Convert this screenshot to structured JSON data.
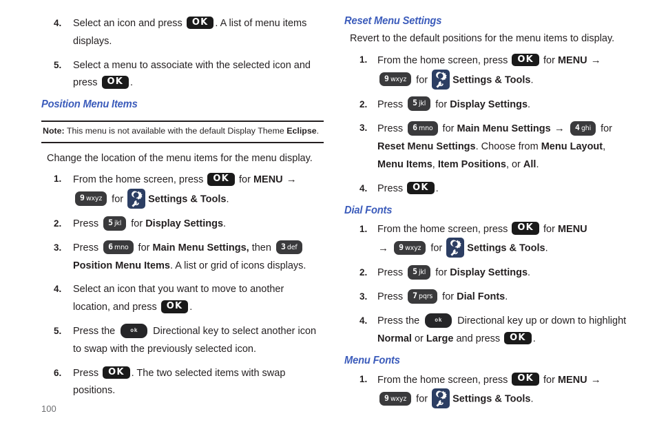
{
  "page": {
    "number": "100",
    "icons": {
      "settings_tools": "settings-tools-icon",
      "ok_key": "ok-key-icon",
      "directional_key": "directional-key-icon"
    },
    "colors": {
      "heading_blue": "#3c5cbb",
      "key_black": "#1a1a1a",
      "key_grey": "#3a3a3c",
      "icon_navy": "#2c3e63",
      "page_number_grey": "#6d6e71",
      "text_black": "#231f20"
    }
  },
  "keys": {
    "ok": "OK",
    "dir": "ok",
    "k9": {
      "digit": "9",
      "letters": "wxyz"
    },
    "k5": {
      "digit": "5",
      "letters": "jkl"
    },
    "k6": {
      "digit": "6",
      "letters": "mno"
    },
    "k3": {
      "digit": "3",
      "letters": "def"
    },
    "k4": {
      "digit": "4",
      "letters": "ghi"
    },
    "k7": {
      "digit": "7",
      "letters": "pqrs"
    }
  },
  "left_column": {
    "continued_steps": [
      {
        "num": "4.",
        "parts": [
          {
            "t": "text",
            "v": "Select an icon and press "
          },
          {
            "t": "ok"
          },
          {
            "t": "text",
            "v": ". A list of menu items displays."
          }
        ]
      },
      {
        "num": "5.",
        "parts": [
          {
            "t": "text",
            "v": "Select a menu to associate with the selected icon and press "
          },
          {
            "t": "ok"
          },
          {
            "t": "text",
            "v": "."
          }
        ]
      }
    ],
    "section": {
      "heading": "Position Menu Items",
      "note": {
        "label": "Note:",
        "text_before": " This menu is not available with the default Display Theme ",
        "bold_term": "Eclipse",
        "text_after": "."
      },
      "intro": "Change the location of the menu items for the menu display.",
      "steps": [
        {
          "num": "1.",
          "parts": [
            {
              "t": "text",
              "v": "From the home screen, press "
            },
            {
              "t": "ok"
            },
            {
              "t": "text",
              "v": " for "
            },
            {
              "t": "bold",
              "v": "MENU"
            },
            {
              "t": "arrow"
            },
            {
              "t": "break"
            },
            {
              "t": "key",
              "v": "k9"
            },
            {
              "t": "text",
              "v": " for "
            },
            {
              "t": "sticon"
            },
            {
              "t": "bold",
              "v": "Settings & Tools"
            },
            {
              "t": "text",
              "v": "."
            }
          ]
        },
        {
          "num": "2.",
          "parts": [
            {
              "t": "text",
              "v": "Press "
            },
            {
              "t": "key",
              "v": "k5"
            },
            {
              "t": "text",
              "v": " for "
            },
            {
              "t": "bold",
              "v": "Display Settings"
            },
            {
              "t": "text",
              "v": "."
            }
          ]
        },
        {
          "num": "3.",
          "parts": [
            {
              "t": "text",
              "v": "Press "
            },
            {
              "t": "key",
              "v": "k6"
            },
            {
              "t": "text",
              "v": " for "
            },
            {
              "t": "bold",
              "v": "Main Menu Settings,"
            },
            {
              "t": "text",
              "v": " then "
            },
            {
              "t": "key",
              "v": "k3"
            },
            {
              "t": "break"
            },
            {
              "t": "bold",
              "v": "Position Menu Items"
            },
            {
              "t": "text",
              "v": ". A list or grid of icons displays."
            }
          ]
        },
        {
          "num": "4.",
          "parts": [
            {
              "t": "text",
              "v": "Select an icon that you want to move to another location, and press "
            },
            {
              "t": "ok"
            },
            {
              "t": "text",
              "v": "."
            }
          ]
        },
        {
          "num": "5.",
          "parts": [
            {
              "t": "text",
              "v": "Press the "
            },
            {
              "t": "dir"
            },
            {
              "t": "text",
              "v": " Directional key to select another icon to swap with the previously selected icon."
            }
          ]
        },
        {
          "num": "6.",
          "parts": [
            {
              "t": "text",
              "v": " Press "
            },
            {
              "t": "ok"
            },
            {
              "t": "text",
              "v": ". The two selected items with swap positions."
            }
          ]
        }
      ]
    }
  },
  "right_column": {
    "sections": [
      {
        "heading": "Reset Menu Settings",
        "intro": "Revert to the default positions for the menu items to display.",
        "steps": [
          {
            "num": "1.",
            "parts": [
              {
                "t": "text",
                "v": "From the home screen, press "
              },
              {
                "t": "ok"
              },
              {
                "t": "text",
                "v": " for "
              },
              {
                "t": "bold",
                "v": "MENU"
              },
              {
                "t": "arrow"
              },
              {
                "t": "break"
              },
              {
                "t": "key",
                "v": "k9"
              },
              {
                "t": "text",
                "v": " for "
              },
              {
                "t": "sticon"
              },
              {
                "t": "bold",
                "v": "Settings & Tools"
              },
              {
                "t": "text",
                "v": "."
              }
            ]
          },
          {
            "num": "2.",
            "parts": [
              {
                "t": "text",
                "v": "Press "
              },
              {
                "t": "key",
                "v": "k5"
              },
              {
                "t": "text",
                "v": " for "
              },
              {
                "t": "bold",
                "v": "Display Settings"
              },
              {
                "t": "text",
                "v": "."
              }
            ]
          },
          {
            "num": "3.",
            "parts": [
              {
                "t": "text",
                "v": "Press "
              },
              {
                "t": "key",
                "v": "k6"
              },
              {
                "t": "text",
                "v": " for "
              },
              {
                "t": "bold",
                "v": "Main Menu Settings"
              },
              {
                "t": "arrow"
              },
              {
                "t": "key",
                "v": "k4"
              },
              {
                "t": "text",
                "v": " for "
              },
              {
                "t": "break"
              },
              {
                "t": "bold",
                "v": "Reset Menu Settings"
              },
              {
                "t": "text",
                "v": ". Choose from "
              },
              {
                "t": "bold",
                "v": "Menu Layout"
              },
              {
                "t": "text",
                "v": ", "
              },
              {
                "t": "bold",
                "v": "Menu Items"
              },
              {
                "t": "text",
                "v": ", "
              },
              {
                "t": "bold",
                "v": "Item Positions"
              },
              {
                "t": "text",
                "v": ", or "
              },
              {
                "t": "bold",
                "v": "All"
              },
              {
                "t": "text",
                "v": "."
              }
            ]
          },
          {
            "num": "4.",
            "parts": [
              {
                "t": "text",
                "v": "Press "
              },
              {
                "t": "ok"
              },
              {
                "t": "text",
                "v": "."
              }
            ]
          }
        ]
      },
      {
        "heading": "Dial Fonts",
        "intro": "",
        "steps": [
          {
            "num": "1.",
            "parts": [
              {
                "t": "text",
                "v": "From the home screen, press "
              },
              {
                "t": "ok"
              },
              {
                "t": "text",
                "v": " for "
              },
              {
                "t": "bold",
                "v": "MENU"
              },
              {
                "t": "break"
              },
              {
                "t": "arrow"
              },
              {
                "t": "key",
                "v": "k9"
              },
              {
                "t": "text",
                "v": " for "
              },
              {
                "t": "sticon"
              },
              {
                "t": "bold",
                "v": "Settings & Tools"
              },
              {
                "t": "text",
                "v": "."
              }
            ]
          },
          {
            "num": "2.",
            "parts": [
              {
                "t": "text",
                "v": "Press "
              },
              {
                "t": "key",
                "v": "k5"
              },
              {
                "t": "text",
                "v": " for "
              },
              {
                "t": "bold",
                "v": "Display Settings"
              },
              {
                "t": "text",
                "v": "."
              }
            ]
          },
          {
            "num": "3.",
            "parts": [
              {
                "t": "text",
                "v": "Press "
              },
              {
                "t": "key",
                "v": "k7"
              },
              {
                "t": "text",
                "v": " for "
              },
              {
                "t": "bold",
                "v": "Dial Fonts"
              },
              {
                "t": "text",
                "v": "."
              }
            ]
          },
          {
            "num": "4.",
            "parts": [
              {
                "t": "text",
                "v": "Press the "
              },
              {
                "t": "dir"
              },
              {
                "t": "text",
                "v": " Directional key up or down to highlight "
              },
              {
                "t": "break"
              },
              {
                "t": "bold",
                "v": "Normal"
              },
              {
                "t": "text",
                "v": " or "
              },
              {
                "t": "bold",
                "v": "Large"
              },
              {
                "t": "text",
                "v": " and press "
              },
              {
                "t": "ok"
              },
              {
                "t": "text",
                "v": "."
              }
            ]
          }
        ]
      },
      {
        "heading": "Menu Fonts",
        "intro": "",
        "steps": [
          {
            "num": "1.",
            "parts": [
              {
                "t": "text",
                "v": "From the home screen, press "
              },
              {
                "t": "ok"
              },
              {
                "t": "text",
                "v": " for "
              },
              {
                "t": "bold",
                "v": "MENU"
              },
              {
                "t": "arrow"
              },
              {
                "t": "break"
              },
              {
                "t": "key",
                "v": "k9"
              },
              {
                "t": "text",
                "v": " for "
              },
              {
                "t": "sticon"
              },
              {
                "t": "bold",
                "v": "Settings & Tools"
              },
              {
                "t": "text",
                "v": "."
              }
            ]
          }
        ]
      }
    ]
  }
}
